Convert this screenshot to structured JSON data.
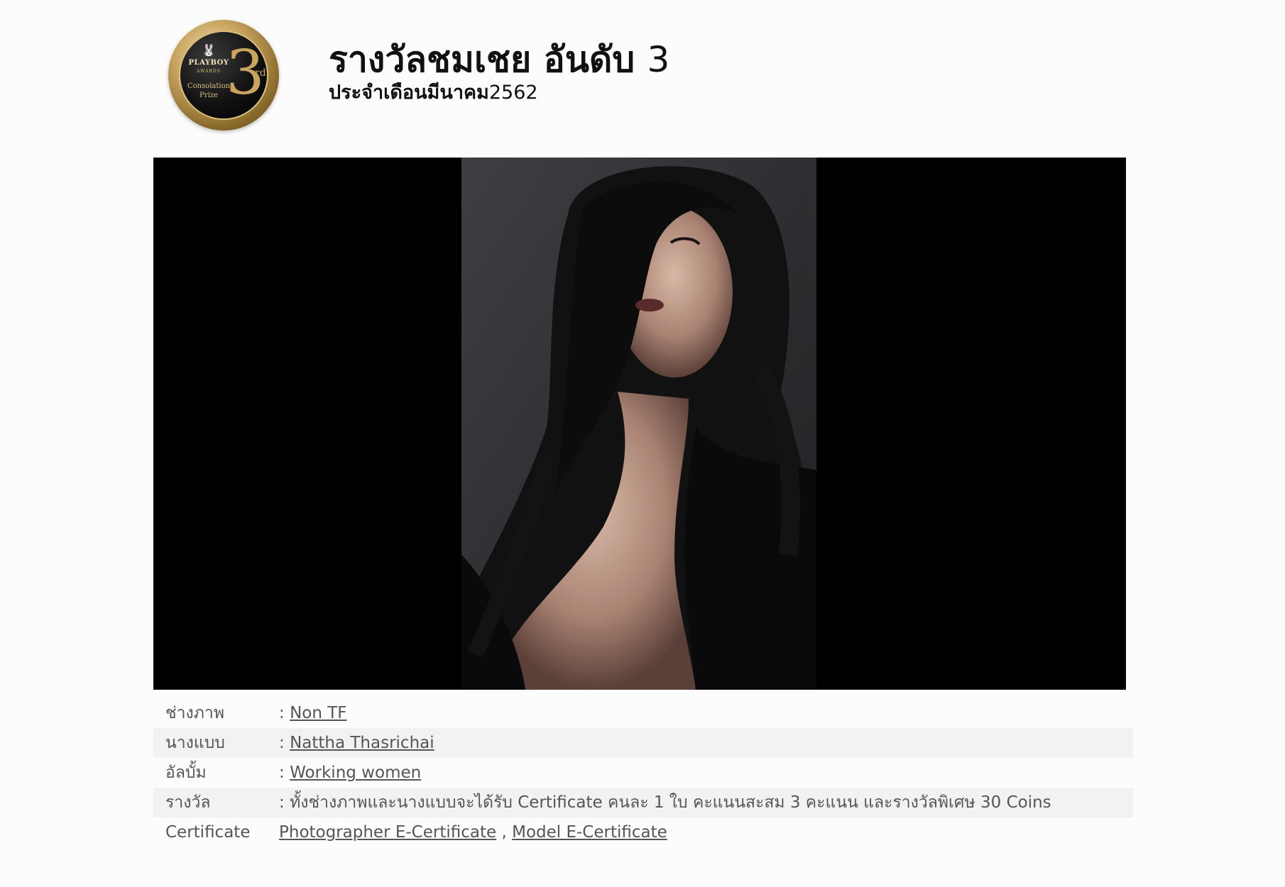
{
  "header": {
    "title_text": "รางวัลชมเชย อันดับ",
    "title_number": "3",
    "subtitle_text": "ประจำเดือนมีนาคม",
    "subtitle_year": "2562"
  },
  "badge": {
    "brand": "PLAYBOY",
    "sub": "AWARDS",
    "prize_line1": "Consolation",
    "prize_line2": "Prize",
    "number": "3",
    "suffix": "rd",
    "icon": "bunny-icon"
  },
  "photo": {
    "description_icon": "portrait-photo"
  },
  "info": {
    "separator": ":",
    "photographer_label": "ช่างภาพ",
    "photographer_value": "Non TF",
    "model_label": "นางแบบ",
    "model_value": "Nattha Thasrichai",
    "album_label": "อัลบั้ม",
    "album_value": "Working women",
    "prize_label": "รางวัล",
    "prize_value": "ทั้งช่างภาพและนางแบบจะได้รับ Certificate คนละ 1 ใบ คะแนนสะสม 3 คะแนน และรางวัลพิเศษ 30 Coins",
    "certificate_label": "Certificate",
    "certificate_photographer": "Photographer E-Certificate",
    "certificate_comma": ",",
    "certificate_model": "Model E-Certificate"
  },
  "colors": {
    "page_background": "#fcfcfc",
    "photo_background": "#000000",
    "alt_row": "#f2f2f2",
    "badge_gold": "#c9a560"
  }
}
